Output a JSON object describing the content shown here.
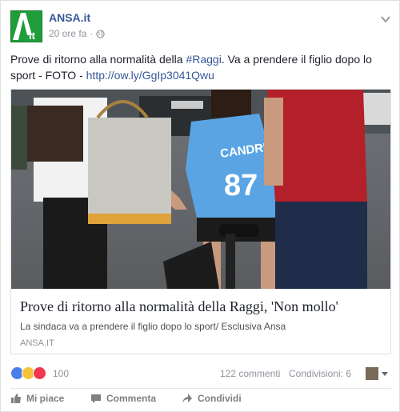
{
  "post": {
    "page_name": "ANSA.it",
    "time": "20 ore fa",
    "separator": "·",
    "logo_text": "A",
    "logo_sub": "it",
    "text": {
      "before_hashtag": "Prove di ritorno alla normalità della ",
      "hashtag": "#Raggi",
      "after_hashtag": ". Va a prendere il figlio dopo lo sport - FOTO - ",
      "url": "http://ow.ly/GgIp3041Qwu"
    }
  },
  "link_card": {
    "title": "Prove di ritorno alla normalità della Raggi, 'Non mollo'",
    "description": "La sindaca va a prendere il figlio dopo lo sport/ Esclusiva Ansa",
    "domain": "ANSA.IT",
    "jersey_name": "CANDRIVA",
    "jersey_number": "87"
  },
  "stats": {
    "reactions": "100",
    "comments": "122 commenti",
    "shares": "Condivisioni: 6"
  },
  "actions": {
    "like": "Mi piace",
    "comment": "Commenta",
    "share": "Condividi"
  },
  "colors": {
    "link": "#365899",
    "logo_green": "#1f9d3a",
    "meta_gray": "#90949c"
  }
}
